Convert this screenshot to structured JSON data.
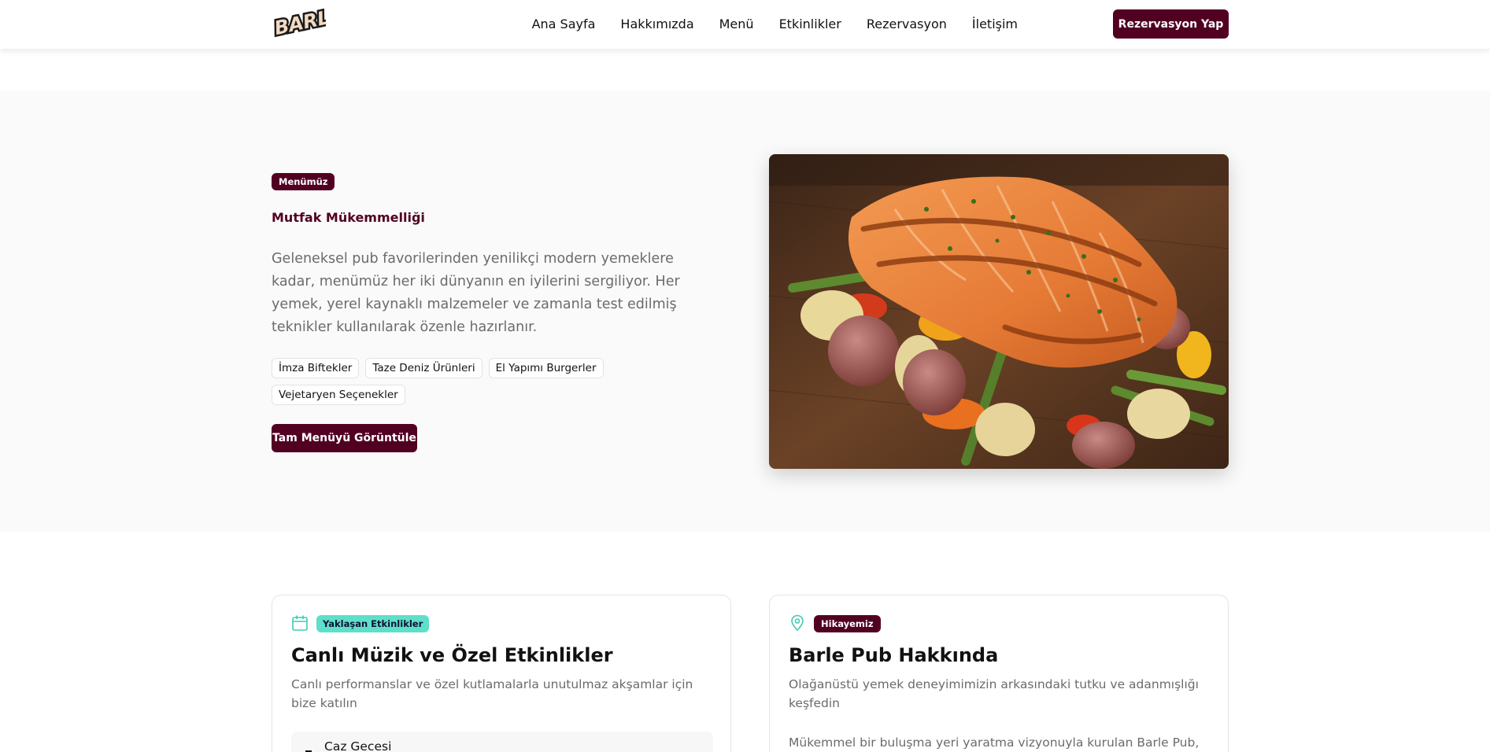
{
  "brand": {
    "logo_text": "Barle"
  },
  "nav": {
    "links": [
      "Ana Sayfa",
      "Hakkımızda",
      "Menü",
      "Etkinlikler",
      "Rezervasyon",
      "İletişim"
    ],
    "cta": "Rezervasyon Yap"
  },
  "menu_section": {
    "badge": "Menümüz",
    "subtitle": "Mutfak Mükemmelliği",
    "description": "Geleneksel pub favorilerinden yenilikçi modern yemeklere kadar, menümüz her iki dünyanın en iyilerini sergiliyor. Her yemek, yerel kaynaklı malzemeler ve zamanla test edilmiş teknikler kullanılarak özenle hazırlanır.",
    "tags": [
      "İmza Biftekler",
      "Taze Deniz Ürünleri",
      "El Yapımı Burgerler",
      "Vejetaryen Seçenekler"
    ],
    "button": "Tam Menüyü Görüntüle"
  },
  "events_card": {
    "icon": "calendar-icon",
    "badge": "Yaklaşan Etkinlikler",
    "title": "Canlı Müzik ve Özel Etkinlikler",
    "description": "Canlı performanslar ve özel kutlamalarla unutulmaz akşamlar için bize katılın",
    "first_event": "Caz Gecesi"
  },
  "about_card": {
    "icon": "map-pin-icon",
    "badge": "Hikayemiz",
    "title": "Barle Pub Hakkında",
    "description": "Olağanüstü yemek deneyimimizin arkasındaki tutku ve adanmışlığı keşfedin",
    "body": "Mükemmel bir buluşma yeri yaratma vizyonuyla kurulan Barle Pub,"
  },
  "colors": {
    "accent": "#520022",
    "teal": "#5edfc9",
    "muted": "#6b6b6b",
    "section_bg": "#fafafa"
  }
}
